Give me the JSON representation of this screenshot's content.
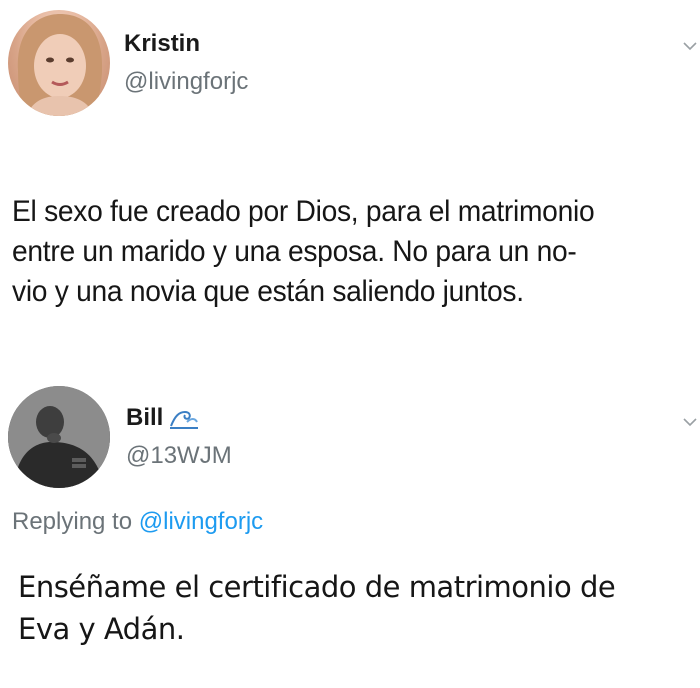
{
  "tweets": [
    {
      "name": "Kristin",
      "handle": "@livingforjc",
      "text": "El sexo fue creado por Dios, para el matrimonio\nentre un marido y una esposa. No para un no-\nvio y una novia que están saliendo juntos."
    },
    {
      "name": "Bill",
      "name_icon": "wave-emoji-icon",
      "handle": "@13WJM",
      "replying_prefix": "Replying to",
      "replying_handle": "@livingforjc",
      "text": "Enséñame el certificado de matrimonio de\nEva y Adán."
    }
  ],
  "colors": {
    "handle": "#6b7378",
    "link": "#1d9bf0",
    "text": "#161616"
  }
}
